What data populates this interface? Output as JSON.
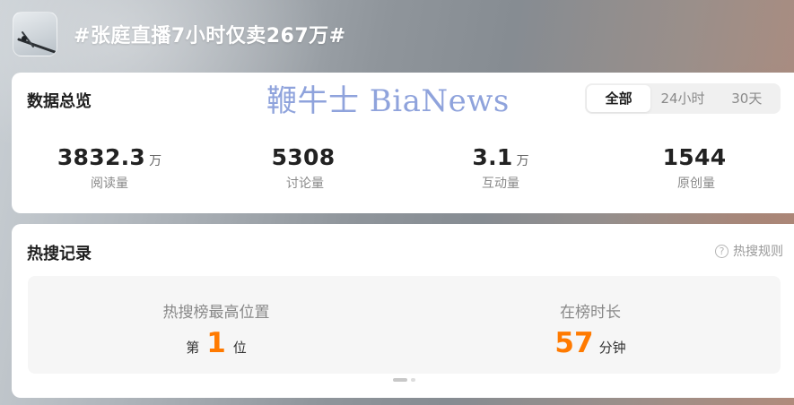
{
  "topic": {
    "title": "#张庭直播7小时仅卖267万#"
  },
  "overview": {
    "title": "数据总览",
    "tabs": [
      {
        "label": "全部",
        "active": true
      },
      {
        "label": "24小时",
        "active": false
      },
      {
        "label": "30天",
        "active": false
      }
    ],
    "stats": [
      {
        "value": "3832.3",
        "unit": "万",
        "label": "阅读量"
      },
      {
        "value": "5308",
        "unit": "",
        "label": "讨论量"
      },
      {
        "value": "3.1",
        "unit": "万",
        "label": "互动量"
      },
      {
        "value": "1544",
        "unit": "",
        "label": "原创量"
      }
    ]
  },
  "hot_search": {
    "title": "热搜记录",
    "rules_label": "热搜规则",
    "help_icon": "?",
    "peak": {
      "label": "热搜榜最高位置",
      "prefix": "第",
      "value": "1",
      "suffix": "位"
    },
    "duration": {
      "label": "在榜时长",
      "value": "57",
      "unit": "分钟"
    },
    "pager": {
      "current": 1,
      "total": 2
    }
  },
  "watermark": "鞭牛士 BiaNews",
  "colors": {
    "accent_orange": "#ff7a00",
    "watermark_blue": "#7c93d6"
  },
  "icons": {
    "thumbnail": "topic-thumbnail",
    "help": "help-circle-icon"
  }
}
